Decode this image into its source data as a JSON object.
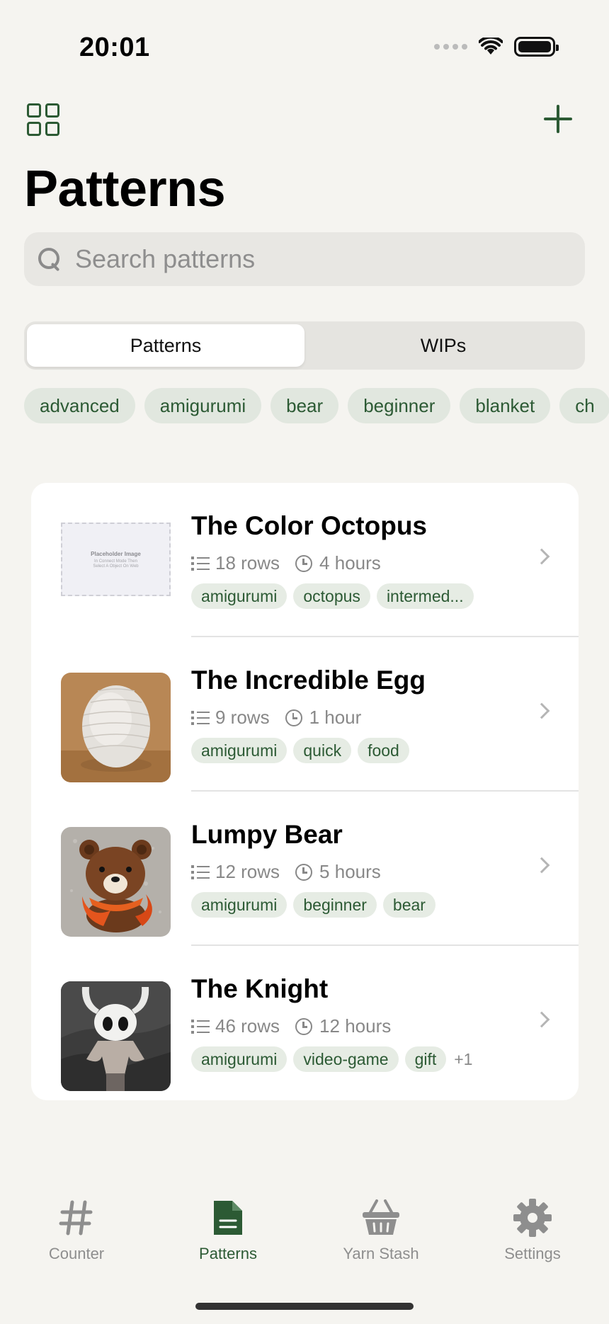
{
  "status_bar": {
    "time": "20:01"
  },
  "header": {
    "title": "Patterns"
  },
  "search": {
    "placeholder": "Search patterns"
  },
  "segments": [
    {
      "label": "Patterns",
      "active": true
    },
    {
      "label": "WIPs",
      "active": false
    }
  ],
  "tags": [
    "advanced",
    "amigurumi",
    "bear",
    "beginner",
    "blanket",
    "ch"
  ],
  "patterns": [
    {
      "name": "The Color Octopus",
      "rows": "18 rows",
      "time": "4 hours",
      "tags": [
        "amigurumi",
        "octopus",
        "intermed..."
      ],
      "more": "",
      "thumb": {
        "kind": "placeholder",
        "title": "Placeholder Image",
        "sub1": "In Connect Mode Then",
        "sub2": "Select A Object On Web"
      }
    },
    {
      "name": "The Incredible Egg",
      "rows": "9 rows",
      "time": "1 hour",
      "tags": [
        "amigurumi",
        "quick",
        "food"
      ],
      "more": "",
      "thumb": {
        "kind": "egg"
      }
    },
    {
      "name": "Lumpy Bear",
      "rows": "12 rows",
      "time": "5 hours",
      "tags": [
        "amigurumi",
        "beginner",
        "bear"
      ],
      "more": "",
      "thumb": {
        "kind": "bear"
      }
    },
    {
      "name": "The Knight",
      "rows": "46 rows",
      "time": "12 hours",
      "tags": [
        "amigurumi",
        "video-game",
        "gift"
      ],
      "more": "+1",
      "thumb": {
        "kind": "knight"
      }
    }
  ],
  "tab_bar": [
    {
      "label": "Counter",
      "icon": "hash-icon",
      "active": false
    },
    {
      "label": "Patterns",
      "icon": "document-icon",
      "active": true
    },
    {
      "label": "Yarn Stash",
      "icon": "basket-icon",
      "active": false
    },
    {
      "label": "Settings",
      "icon": "gear-icon",
      "active": false
    }
  ],
  "colors": {
    "accent": "#2c5a34",
    "background": "#f5f4f0",
    "chip": "#e1e7df"
  }
}
